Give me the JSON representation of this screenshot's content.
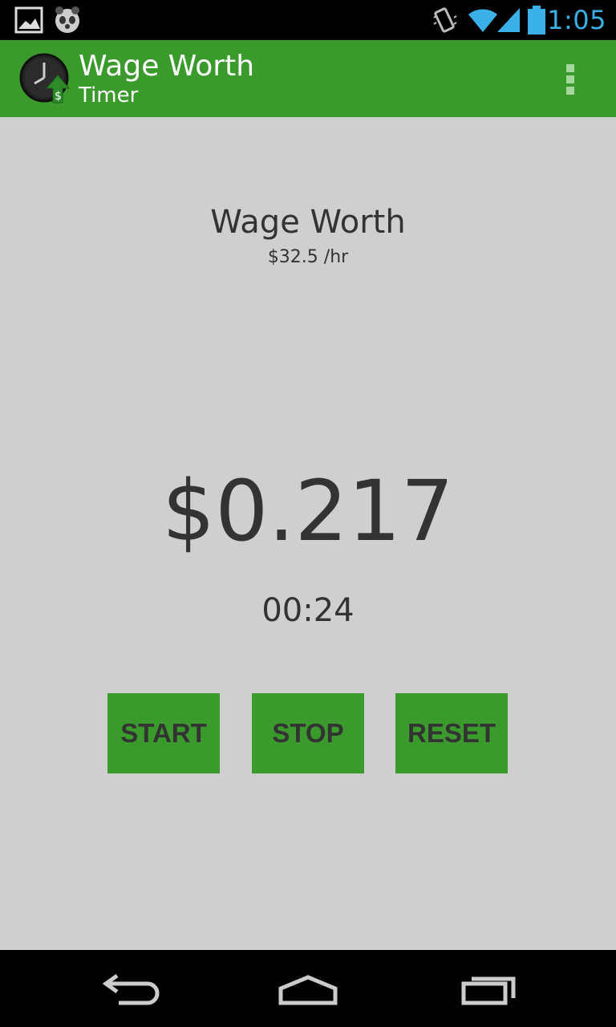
{
  "status_bar": {
    "time": "1:05",
    "icons": [
      "gallery-icon",
      "panda-icon",
      "vibrate-icon",
      "wifi-icon",
      "signal-icon",
      "battery-icon"
    ]
  },
  "action_bar": {
    "title": "Wage Worth",
    "subtitle": "Timer",
    "app_icon": "clock-dollar-icon",
    "menu_icon": "overflow-menu-icon"
  },
  "main": {
    "heading": "Wage Worth",
    "rate": "$32.5 /hr",
    "amount": "$0.217",
    "elapsed": "00:24"
  },
  "buttons": {
    "start": "START",
    "stop": "STOP",
    "reset": "RESET"
  },
  "nav_bar": {
    "icons": [
      "back-icon",
      "home-icon",
      "recents-icon"
    ]
  },
  "colors": {
    "accent": "#3a9a2b",
    "background": "#cfcfcf",
    "status_time": "#3ab0e6",
    "text": "#333333"
  }
}
